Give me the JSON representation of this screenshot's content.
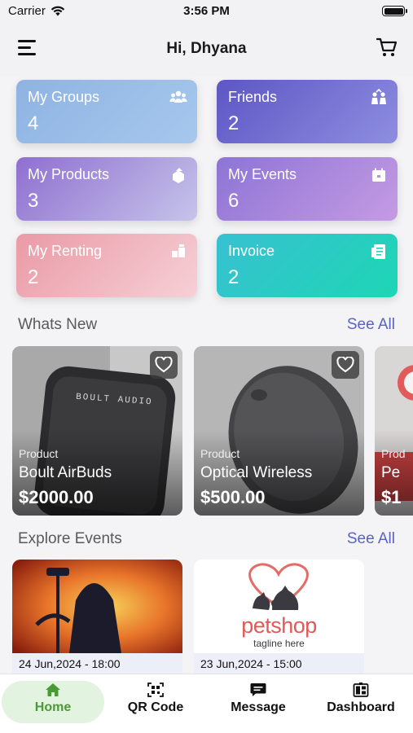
{
  "status_bar": {
    "carrier": "Carrier",
    "time": "3:56 PM"
  },
  "header": {
    "title": "Hi, Dhyana",
    "menu_icon": "hamburger-menu-icon",
    "cart_icon": "cart-icon"
  },
  "stats": [
    {
      "label": "My Groups",
      "count": "4",
      "icon": "groups-icon",
      "colors": [
        "#8fb3e2",
        "#a6c8ee"
      ]
    },
    {
      "label": "Friends",
      "count": "2",
      "icon": "friends-icon",
      "colors": [
        "#5d56c4",
        "#8e8ee0"
      ]
    },
    {
      "label": "My Products",
      "count": "3",
      "icon": "products-icon",
      "colors": [
        "#8f6fd0",
        "#c6c4ea"
      ]
    },
    {
      "label": "My Events",
      "count": "6",
      "icon": "events-icon",
      "colors": [
        "#8d74d6",
        "#c59be3"
      ]
    },
    {
      "label": "My Renting",
      "count": "2",
      "icon": "renting-icon",
      "colors": [
        "#ea9aa6",
        "#f6d0d6"
      ]
    },
    {
      "label": "Invoice",
      "count": "2",
      "icon": "invoice-icon",
      "colors": [
        "#38c1d2",
        "#1dd6b4"
      ]
    }
  ],
  "whats_new": {
    "title": "Whats New",
    "see_all": "See All",
    "products": [
      {
        "category": "Product",
        "name": "Boult AirBuds",
        "price": "$2000.00",
        "image_text": "BOULT AUDIO"
      },
      {
        "category": "Product",
        "name": "Optical Wireless",
        "price": "$500.00"
      },
      {
        "category": "Prod",
        "name": "Pe",
        "price": "$1"
      }
    ]
  },
  "explore_events": {
    "title": "Explore Events",
    "see_all": "See All",
    "events": [
      {
        "date": "24 Jun,2024 - 18:00"
      },
      {
        "date": "23 Jun,2024 - 15:00",
        "logo_text": "petshop",
        "logo_tagline": "tagline here"
      }
    ]
  },
  "tabs": [
    {
      "label": "Home",
      "icon": "home-icon",
      "active": true
    },
    {
      "label": "QR Code",
      "icon": "qr-code-icon",
      "active": false
    },
    {
      "label": "Message",
      "icon": "message-icon",
      "active": false
    },
    {
      "label": "Dashboard",
      "icon": "dashboard-icon",
      "active": false
    }
  ]
}
